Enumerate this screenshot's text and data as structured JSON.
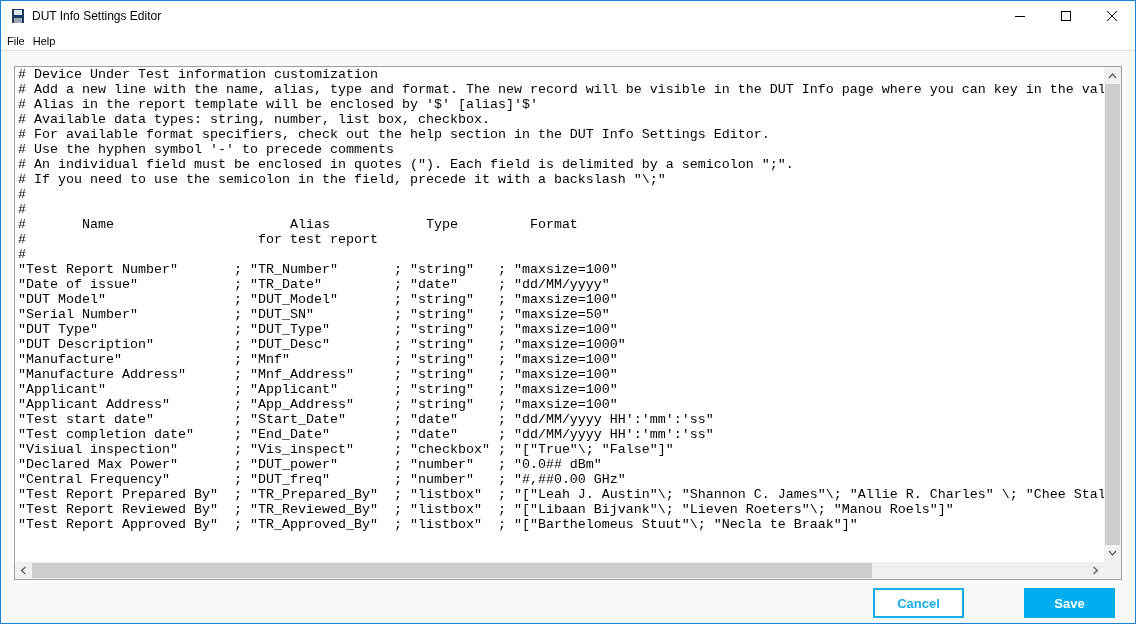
{
  "window": {
    "title": "DUT Info Settings Editor"
  },
  "menu": [
    "File",
    "Help"
  ],
  "editor": {
    "lines": [
      "# Device Under Test information customization",
      "# Add a new line with the name, alias, type and format. The new record will be visible in the DUT Info page where you can key in the val",
      "# Alias in the report template will be enclosed by '$' [alias]'$'",
      "# Available data types: string, number, list box, checkbox.",
      "# For available format specifiers, check out the help section in the DUT Info Settings Editor.",
      "# Use the hyphen symbol '-' to precede comments",
      "# An individual field must be enclosed in quotes (\"). Each field is delimited by a semicolon \";\".",
      "# If you need to use the semicolon in the field, precede it with a backslash \"\\;\"",
      "#",
      "#",
      "#       Name                      Alias            Type         Format",
      "#                             for test report",
      "#",
      "\"Test Report Number\"       ; \"TR_Number\"       ; \"string\"   ; \"maxsize=100\"",
      "\"Date of issue\"            ; \"TR_Date\"         ; \"date\"     ; \"dd/MM/yyyy\"",
      "\"DUT Model\"                ; \"DUT_Model\"       ; \"string\"   ; \"maxsize=100\"",
      "\"Serial Number\"            ; \"DUT_SN\"          ; \"string\"   ; \"maxsize=50\"",
      "\"DUT Type\"                 ; \"DUT_Type\"        ; \"string\"   ; \"maxsize=100\"",
      "\"DUT Description\"          ; \"DUT_Desc\"        ; \"string\"   ; \"maxsize=1000\"",
      "\"Manufacture\"              ; \"Mnf\"             ; \"string\"   ; \"maxsize=100\"",
      "\"Manufacture Address\"      ; \"Mnf_Address\"     ; \"string\"   ; \"maxsize=100\"",
      "\"Applicant\"                ; \"Applicant\"       ; \"string\"   ; \"maxsize=100\"",
      "\"Applicant Address\"        ; \"App_Address\"     ; \"string\"   ; \"maxsize=100\"",
      "\"Test start date\"          ; \"Start_Date\"      ; \"date\"     ; \"dd/MM/yyyy HH':'mm':'ss\"",
      "\"Test completion date\"     ; \"End_Date\"        ; \"date\"     ; \"dd/MM/yyyy HH':'mm':'ss\"",
      "\"Visiual inspection\"       ; \"Vis_inspect\"     ; \"checkbox\" ; \"[\"True\"\\; \"False\"]\"",
      "\"Declared Max Power\"       ; \"DUT_power\"       ; \"number\"   ; \"0.0## dBm\"",
      "\"Central Frequency\"        ; \"DUT_freq\"        ; \"number\"   ; \"#,##0.00 GHz\"",
      "\"Test Report Prepared By\"  ; \"TR_Prepared_By\"  ; \"listbox\"  ; \"[\"Leah J. Austin\"\\; \"Shannon C. James\"\\; \"Allie R. Charles\" \\; \"Chee Stal",
      "\"Test Report Reviewed By\"  ; \"TR_Reviewed_By\"  ; \"listbox\"  ; \"[\"Libaan Bijvank\"\\; \"Lieven Roeters\"\\; \"Manou Roels\"]\"",
      "\"Test Report Approved By\"  ; \"TR_Approved_By\"  ; \"listbox\"  ; \"[\"Barthelomeus Stuut\"\\; \"Necla te Braak\"]\""
    ]
  },
  "buttons": [
    {
      "label": "Cancel",
      "kind": "secondary"
    },
    {
      "label": "Save",
      "kind": "primary"
    }
  ]
}
